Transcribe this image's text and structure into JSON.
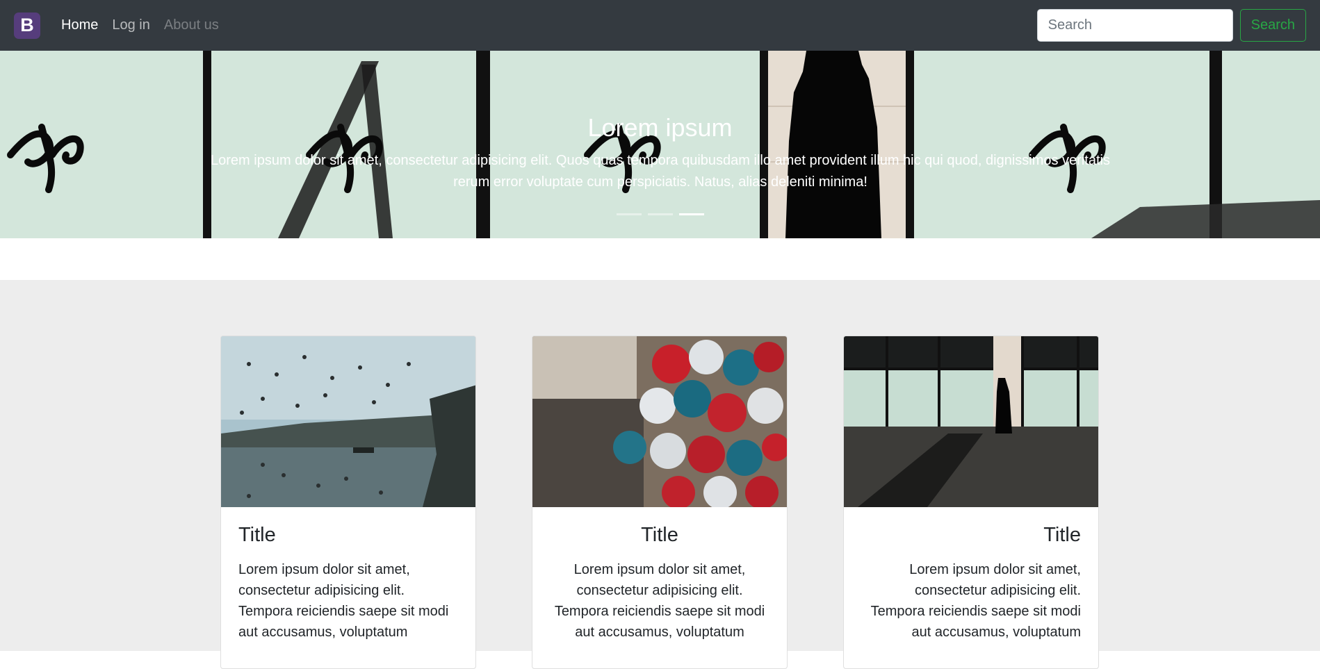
{
  "navbar": {
    "brand_letter": "B",
    "links": [
      {
        "label": "Home"
      },
      {
        "label": "Log in"
      },
      {
        "label": "About us"
      }
    ],
    "search": {
      "placeholder": "Search",
      "button_label": "Search"
    }
  },
  "carousel": {
    "caption_title": "Lorem ipsum",
    "caption_text": "Lorem ipsum dolor sit amet, consectetur adipisicing elit. Quos quas tempora quibusdam illo amet provident illum hic qui quod, dignissimos veritatis rerum error voluptate cum perspiciatis. Natus, alias deleniti minima!",
    "indicator_count": 3,
    "active_indicator": 3
  },
  "cards": [
    {
      "title": "Title",
      "text": "Lorem ipsum dolor sit amet, consectetur adipisicing elit. Tempora reiciendis saepe sit modi aut accusamus, voluptatum",
      "align": "left",
      "image": "seagulls-over-river-photo"
    },
    {
      "title": "Title",
      "text": "Lorem ipsum dolor sit amet, consectetur adipisicing elit. Tempora reiciendis saepe sit modi aut accusamus, voluptatum",
      "align": "center",
      "image": "balloons-crowd-photo"
    },
    {
      "title": "Title",
      "text": "Lorem ipsum dolor sit amet, consectetur adipisicing elit. Tempora reiciendis saepe sit modi aut accusamus, voluptatum",
      "align": "right",
      "image": "silhouette-storefront-photo"
    }
  ],
  "colors": {
    "navbar_bg": "#343a40",
    "brand_bg": "#563d7c",
    "search_button": "#28a745",
    "album_bg": "#ededed"
  }
}
